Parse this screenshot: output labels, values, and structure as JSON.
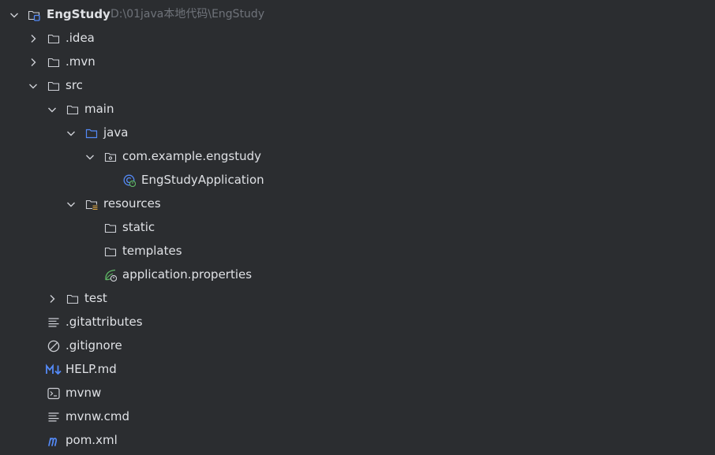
{
  "project": {
    "name": "EngStudy",
    "path": "D:\\01java本地代码\\EngStudy"
  },
  "items": {
    "idea": ".idea",
    "mvn": ".mvn",
    "src": "src",
    "main": "main",
    "java": "java",
    "package": "com.example.engstudy",
    "app_class": "EngStudyApplication",
    "resources": "resources",
    "static": "static",
    "templates": "templates",
    "app_props": "application.properties",
    "test": "test",
    "gitattributes": ".gitattributes",
    "gitignore": ".gitignore",
    "help": "HELP.md",
    "mvnw": "mvnw",
    "mvnw_cmd": "mvnw.cmd",
    "pom": "pom.xml"
  },
  "icons": {
    "project": "module-folder-icon",
    "folder": "folder-icon",
    "source_root": "source-root-folder-icon",
    "package": "package-icon",
    "spring_boot_app": "spring-boot-application-icon",
    "resources_root": "resources-root-folder-icon",
    "spring_properties": "spring-properties-icon",
    "text_file": "text-file-icon",
    "ignore_file": "ignore-file-icon",
    "markdown": "markdown-icon",
    "shell": "shell-script-icon",
    "maven": "maven-icon"
  },
  "colors": {
    "background": "#2b2d30",
    "text": "#dfe1e5",
    "hint": "#6f737a",
    "icon": "#ced0d6",
    "source_blue": "#548af7",
    "spring_green": "#5fb865",
    "markdown_blue": "#548af7",
    "maven_blue": "#548af7"
  }
}
